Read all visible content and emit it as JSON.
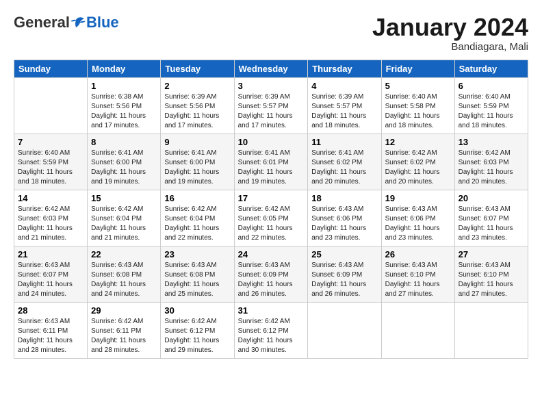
{
  "logo": {
    "general": "General",
    "blue": "Blue"
  },
  "title": "January 2024",
  "subtitle": "Bandiagara, Mali",
  "headers": [
    "Sunday",
    "Monday",
    "Tuesday",
    "Wednesday",
    "Thursday",
    "Friday",
    "Saturday"
  ],
  "weeks": [
    [
      {
        "num": "",
        "info": ""
      },
      {
        "num": "1",
        "info": "Sunrise: 6:38 AM\nSunset: 5:56 PM\nDaylight: 11 hours and 17 minutes."
      },
      {
        "num": "2",
        "info": "Sunrise: 6:39 AM\nSunset: 5:56 PM\nDaylight: 11 hours and 17 minutes."
      },
      {
        "num": "3",
        "info": "Sunrise: 6:39 AM\nSunset: 5:57 PM\nDaylight: 11 hours and 17 minutes."
      },
      {
        "num": "4",
        "info": "Sunrise: 6:39 AM\nSunset: 5:57 PM\nDaylight: 11 hours and 18 minutes."
      },
      {
        "num": "5",
        "info": "Sunrise: 6:40 AM\nSunset: 5:58 PM\nDaylight: 11 hours and 18 minutes."
      },
      {
        "num": "6",
        "info": "Sunrise: 6:40 AM\nSunset: 5:59 PM\nDaylight: 11 hours and 18 minutes."
      }
    ],
    [
      {
        "num": "7",
        "info": "Sunrise: 6:40 AM\nSunset: 5:59 PM\nDaylight: 11 hours and 18 minutes."
      },
      {
        "num": "8",
        "info": "Sunrise: 6:41 AM\nSunset: 6:00 PM\nDaylight: 11 hours and 19 minutes."
      },
      {
        "num": "9",
        "info": "Sunrise: 6:41 AM\nSunset: 6:00 PM\nDaylight: 11 hours and 19 minutes."
      },
      {
        "num": "10",
        "info": "Sunrise: 6:41 AM\nSunset: 6:01 PM\nDaylight: 11 hours and 19 minutes."
      },
      {
        "num": "11",
        "info": "Sunrise: 6:41 AM\nSunset: 6:02 PM\nDaylight: 11 hours and 20 minutes."
      },
      {
        "num": "12",
        "info": "Sunrise: 6:42 AM\nSunset: 6:02 PM\nDaylight: 11 hours and 20 minutes."
      },
      {
        "num": "13",
        "info": "Sunrise: 6:42 AM\nSunset: 6:03 PM\nDaylight: 11 hours and 20 minutes."
      }
    ],
    [
      {
        "num": "14",
        "info": "Sunrise: 6:42 AM\nSunset: 6:03 PM\nDaylight: 11 hours and 21 minutes."
      },
      {
        "num": "15",
        "info": "Sunrise: 6:42 AM\nSunset: 6:04 PM\nDaylight: 11 hours and 21 minutes."
      },
      {
        "num": "16",
        "info": "Sunrise: 6:42 AM\nSunset: 6:04 PM\nDaylight: 11 hours and 22 minutes."
      },
      {
        "num": "17",
        "info": "Sunrise: 6:42 AM\nSunset: 6:05 PM\nDaylight: 11 hours and 22 minutes."
      },
      {
        "num": "18",
        "info": "Sunrise: 6:43 AM\nSunset: 6:06 PM\nDaylight: 11 hours and 23 minutes."
      },
      {
        "num": "19",
        "info": "Sunrise: 6:43 AM\nSunset: 6:06 PM\nDaylight: 11 hours and 23 minutes."
      },
      {
        "num": "20",
        "info": "Sunrise: 6:43 AM\nSunset: 6:07 PM\nDaylight: 11 hours and 23 minutes."
      }
    ],
    [
      {
        "num": "21",
        "info": "Sunrise: 6:43 AM\nSunset: 6:07 PM\nDaylight: 11 hours and 24 minutes."
      },
      {
        "num": "22",
        "info": "Sunrise: 6:43 AM\nSunset: 6:08 PM\nDaylight: 11 hours and 24 minutes."
      },
      {
        "num": "23",
        "info": "Sunrise: 6:43 AM\nSunset: 6:08 PM\nDaylight: 11 hours and 25 minutes."
      },
      {
        "num": "24",
        "info": "Sunrise: 6:43 AM\nSunset: 6:09 PM\nDaylight: 11 hours and 26 minutes."
      },
      {
        "num": "25",
        "info": "Sunrise: 6:43 AM\nSunset: 6:09 PM\nDaylight: 11 hours and 26 minutes."
      },
      {
        "num": "26",
        "info": "Sunrise: 6:43 AM\nSunset: 6:10 PM\nDaylight: 11 hours and 27 minutes."
      },
      {
        "num": "27",
        "info": "Sunrise: 6:43 AM\nSunset: 6:10 PM\nDaylight: 11 hours and 27 minutes."
      }
    ],
    [
      {
        "num": "28",
        "info": "Sunrise: 6:43 AM\nSunset: 6:11 PM\nDaylight: 11 hours and 28 minutes."
      },
      {
        "num": "29",
        "info": "Sunrise: 6:42 AM\nSunset: 6:11 PM\nDaylight: 11 hours and 28 minutes."
      },
      {
        "num": "30",
        "info": "Sunrise: 6:42 AM\nSunset: 6:12 PM\nDaylight: 11 hours and 29 minutes."
      },
      {
        "num": "31",
        "info": "Sunrise: 6:42 AM\nSunset: 6:12 PM\nDaylight: 11 hours and 30 minutes."
      },
      {
        "num": "",
        "info": ""
      },
      {
        "num": "",
        "info": ""
      },
      {
        "num": "",
        "info": ""
      }
    ]
  ]
}
